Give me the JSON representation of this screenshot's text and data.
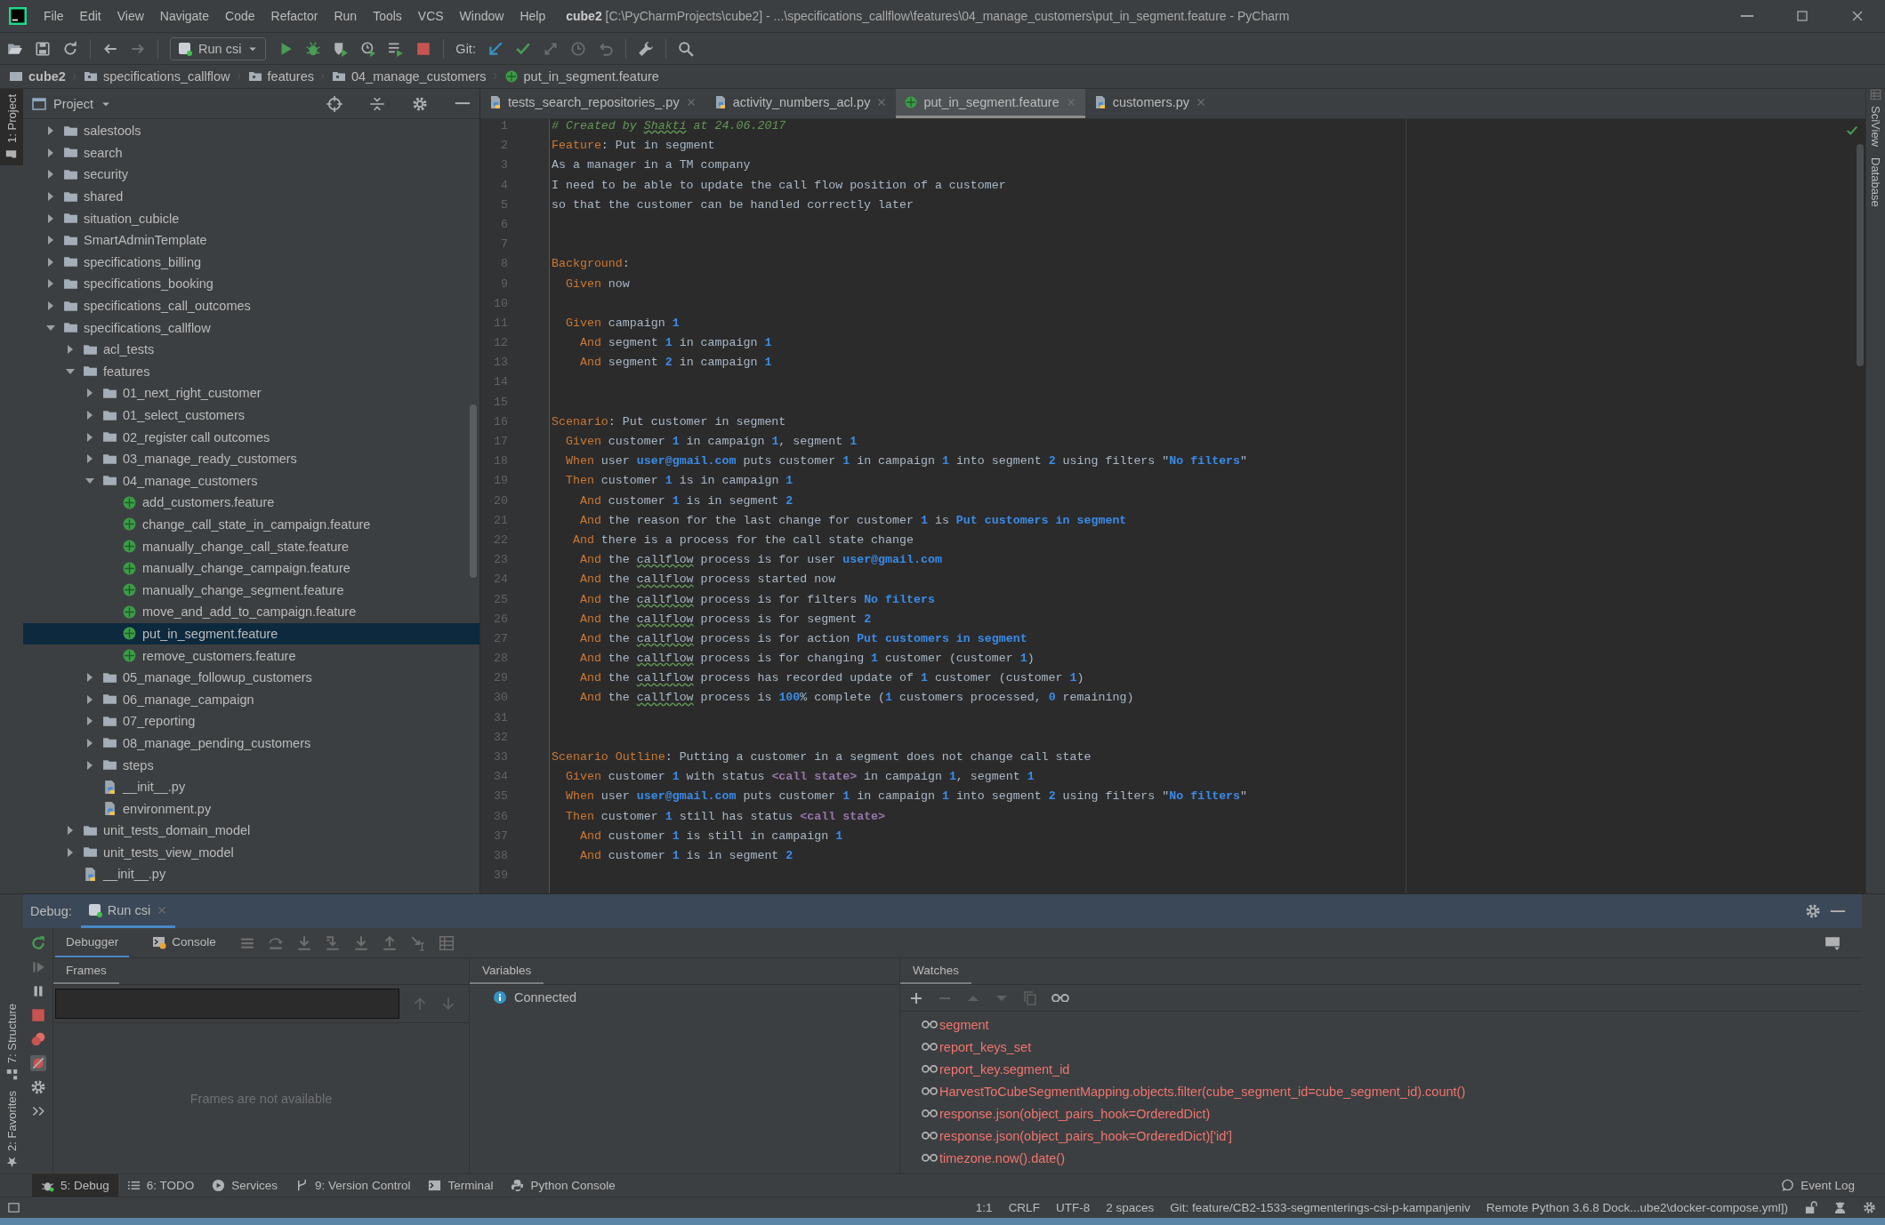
{
  "window": {
    "title": "**cube2** [C:\\PyCharmProjects\\cube2] - ...\\specifications_callflow\\features\\04_manage_customers\\put_in_segment.feature - PyCharm"
  },
  "menu": [
    "File",
    "Edit",
    "View",
    "Navigate",
    "Code",
    "Refactor",
    "Run",
    "Tools",
    "VCS",
    "Window",
    "Help"
  ],
  "toolbar": {
    "run_configuration": "Run csi",
    "vcs_label": "Git:"
  },
  "breadcrumbs": [
    {
      "text": "cube2",
      "kind": "project"
    },
    {
      "text": "specifications_callflow",
      "kind": "folder"
    },
    {
      "text": "features",
      "kind": "folder"
    },
    {
      "text": "04_manage_customers",
      "kind": "folder"
    },
    {
      "text": "put_in_segment.feature",
      "kind": "feature"
    }
  ],
  "side_stripes": {
    "left_top": [
      "1: Project"
    ],
    "left_bottom": [
      "7: Structure",
      "2: Favorites"
    ],
    "right": [
      "SciView",
      "Database"
    ]
  },
  "project": {
    "title": "Project",
    "tree": [
      {
        "label": "salestools",
        "kind": "folder",
        "expanded": false,
        "selected": false
      },
      {
        "label": "search",
        "kind": "folder",
        "expanded": false,
        "selected": false
      },
      {
        "label": "security",
        "kind": "folder",
        "expanded": false,
        "selected": false
      },
      {
        "label": "shared",
        "kind": "folder",
        "expanded": false,
        "selected": false
      },
      {
        "label": "situation_cubicle",
        "kind": "folder",
        "expanded": false,
        "selected": false
      },
      {
        "label": "SmartAdminTemplate",
        "kind": "folder",
        "expanded": false,
        "selected": false
      },
      {
        "label": "specifications_billing",
        "kind": "folder",
        "expanded": false,
        "selected": false
      },
      {
        "label": "specifications_booking",
        "kind": "folder",
        "expanded": false,
        "selected": false
      },
      {
        "label": "specifications_call_outcomes",
        "kind": "folder",
        "expanded": false,
        "selected": false
      },
      {
        "label": "specifications_callflow",
        "kind": "folder",
        "expanded": true,
        "selected": false,
        "children": [
          {
            "label": "acl_tests",
            "kind": "folder",
            "expanded": false,
            "selected": false
          },
          {
            "label": "features",
            "kind": "folder",
            "expanded": true,
            "selected": false,
            "children": [
              {
                "label": "01_next_right_customer",
                "kind": "folder",
                "expanded": false,
                "selected": false
              },
              {
                "label": "01_select_customers",
                "kind": "folder",
                "expanded": false,
                "selected": false
              },
              {
                "label": "02_register call outcomes",
                "kind": "folder",
                "expanded": false,
                "selected": false
              },
              {
                "label": "03_manage_ready_customers",
                "kind": "folder",
                "expanded": false,
                "selected": false
              },
              {
                "label": "04_manage_customers",
                "kind": "folder",
                "expanded": true,
                "selected": false,
                "children": [
                  {
                    "label": "add_customers.feature",
                    "kind": "feature",
                    "selected": false
                  },
                  {
                    "label": "change_call_state_in_campaign.feature",
                    "kind": "feature",
                    "selected": false
                  },
                  {
                    "label": "manually_change_call_state.feature",
                    "kind": "feature",
                    "selected": false
                  },
                  {
                    "label": "manually_change_campaign.feature",
                    "kind": "feature",
                    "selected": false
                  },
                  {
                    "label": "manually_change_segment.feature",
                    "kind": "feature",
                    "selected": false
                  },
                  {
                    "label": "move_and_add_to_campaign.feature",
                    "kind": "feature",
                    "selected": false
                  },
                  {
                    "label": "put_in_segment.feature",
                    "kind": "feature",
                    "selected": true
                  },
                  {
                    "label": "remove_customers.feature",
                    "kind": "feature",
                    "selected": false
                  }
                ]
              },
              {
                "label": "05_manage_followup_customers",
                "kind": "folder",
                "expanded": false,
                "selected": false
              },
              {
                "label": "06_manage_campaign",
                "kind": "folder",
                "expanded": false,
                "selected": false
              },
              {
                "label": "07_reporting",
                "kind": "folder",
                "expanded": false,
                "selected": false
              },
              {
                "label": "08_manage_pending_customers",
                "kind": "folder",
                "expanded": false,
                "selected": false
              },
              {
                "label": "steps",
                "kind": "folder",
                "expanded": false,
                "selected": false
              },
              {
                "label": "__init__.py",
                "kind": "python",
                "selected": false
              },
              {
                "label": "environment.py",
                "kind": "python",
                "selected": false
              }
            ]
          },
          {
            "label": "unit_tests_domain_model",
            "kind": "folder",
            "expanded": false,
            "selected": false
          },
          {
            "label": "unit_tests_view_model",
            "kind": "folder",
            "expanded": false,
            "selected": false
          },
          {
            "label": "__init__.py",
            "kind": "python",
            "selected": false
          }
        ]
      }
    ]
  },
  "editor": {
    "tabs": [
      {
        "label": "tests_search_repositories_.py",
        "kind": "python",
        "selected": false
      },
      {
        "label": "activity_numbers_acl.py",
        "kind": "python",
        "selected": false
      },
      {
        "label": "put_in_segment.feature",
        "kind": "feature",
        "selected": true
      },
      {
        "label": "customers.py",
        "kind": "python",
        "selected": false
      }
    ],
    "lines": [
      {
        "number": "1",
        "segments": [
          {
            "kind": "comment",
            "text": "# Created by "
          },
          {
            "kind": "comment-typo",
            "text": "Shakti"
          },
          {
            "kind": "comment",
            "text": " at 24.06.2017"
          }
        ]
      },
      {
        "number": "2",
        "segments": [
          {
            "kind": "keyword",
            "text": "Feature"
          },
          {
            "kind": "plain",
            "text": ": Put in segment"
          }
        ]
      },
      {
        "number": "3",
        "segments": [
          {
            "kind": "plain",
            "text": "As a manager in a TM company"
          }
        ]
      },
      {
        "number": "4",
        "segments": [
          {
            "kind": "plain",
            "text": "I need to be able to update the call flow position of a customer"
          }
        ]
      },
      {
        "number": "5",
        "segments": [
          {
            "kind": "plain",
            "text": "so that the customer can be handled correctly later"
          }
        ]
      },
      {
        "number": "6"
      },
      {
        "number": "7"
      },
      {
        "number": "8",
        "segments": [
          {
            "kind": "keyword",
            "text": "Background"
          },
          {
            "kind": "plain",
            "text": ":"
          }
        ]
      },
      {
        "number": "9",
        "segments": [
          {
            "kind": "keyword",
            "text": "  Given"
          },
          {
            "kind": "plain",
            "text": " now"
          }
        ]
      },
      {
        "number": "10"
      },
      {
        "number": "11",
        "segments": [
          {
            "kind": "keyword",
            "text": "  Given"
          },
          {
            "kind": "plain",
            "text": " campaign "
          },
          {
            "kind": "number",
            "text": "1"
          }
        ]
      },
      {
        "number": "12",
        "segments": [
          {
            "kind": "keyword",
            "text": "    And"
          },
          {
            "kind": "plain",
            "text": " segment "
          },
          {
            "kind": "number",
            "text": "1"
          },
          {
            "kind": "plain",
            "text": " in campaign "
          },
          {
            "kind": "number",
            "text": "1"
          }
        ]
      },
      {
        "number": "13",
        "segments": [
          {
            "kind": "keyword",
            "text": "    And"
          },
          {
            "kind": "plain",
            "text": " segment "
          },
          {
            "kind": "number",
            "text": "2"
          },
          {
            "kind": "plain",
            "text": " in campaign "
          },
          {
            "kind": "number",
            "text": "1"
          }
        ]
      },
      {
        "number": "14"
      },
      {
        "number": "15"
      },
      {
        "number": "16",
        "segments": [
          {
            "kind": "keyword",
            "text": "Scenario"
          },
          {
            "kind": "plain",
            "text": ": Put customer in segment"
          }
        ]
      },
      {
        "number": "17",
        "segments": [
          {
            "kind": "keyword",
            "text": "  Given"
          },
          {
            "kind": "plain",
            "text": " customer "
          },
          {
            "kind": "number",
            "text": "1"
          },
          {
            "kind": "plain",
            "text": " in campaign "
          },
          {
            "kind": "number",
            "text": "1"
          },
          {
            "kind": "plain",
            "text": ", segment "
          },
          {
            "kind": "number",
            "text": "1"
          }
        ]
      },
      {
        "number": "18",
        "segments": [
          {
            "kind": "keyword",
            "text": "  When"
          },
          {
            "kind": "plain",
            "text": " user "
          },
          {
            "kind": "string",
            "text": "user@gmail.com"
          },
          {
            "kind": "plain",
            "text": " puts customer "
          },
          {
            "kind": "number",
            "text": "1"
          },
          {
            "kind": "plain",
            "text": " in campaign "
          },
          {
            "kind": "number",
            "text": "1"
          },
          {
            "kind": "plain",
            "text": " into segment "
          },
          {
            "kind": "number",
            "text": "2"
          },
          {
            "kind": "plain",
            "text": " using filters \""
          },
          {
            "kind": "string",
            "text": "No filters"
          },
          {
            "kind": "plain",
            "text": "\""
          }
        ]
      },
      {
        "number": "19",
        "segments": [
          {
            "kind": "keyword",
            "text": "  Then"
          },
          {
            "kind": "plain",
            "text": " customer "
          },
          {
            "kind": "number",
            "text": "1"
          },
          {
            "kind": "plain",
            "text": " is in campaign "
          },
          {
            "kind": "number",
            "text": "1"
          }
        ]
      },
      {
        "number": "20",
        "segments": [
          {
            "kind": "keyword",
            "text": "    And"
          },
          {
            "kind": "plain",
            "text": " customer "
          },
          {
            "kind": "number",
            "text": "1"
          },
          {
            "kind": "plain",
            "text": " is in segment "
          },
          {
            "kind": "number",
            "text": "2"
          }
        ]
      },
      {
        "number": "21",
        "segments": [
          {
            "kind": "keyword",
            "text": "    And"
          },
          {
            "kind": "plain",
            "text": " the reason for the last change for customer "
          },
          {
            "kind": "number",
            "text": "1"
          },
          {
            "kind": "plain",
            "text": " is "
          },
          {
            "kind": "string",
            "text": "Put customers in segment"
          }
        ]
      },
      {
        "number": "22",
        "segments": [
          {
            "kind": "keyword",
            "text": "   And"
          },
          {
            "kind": "plain",
            "text": " there is a process for the call state change"
          }
        ]
      },
      {
        "number": "23",
        "segments": [
          {
            "kind": "keyword",
            "text": "    And"
          },
          {
            "kind": "plain",
            "text": " the "
          },
          {
            "kind": "typo",
            "text": "callflow"
          },
          {
            "kind": "plain",
            "text": " process is for user "
          },
          {
            "kind": "string",
            "text": "user@gmail.com"
          }
        ]
      },
      {
        "number": "24",
        "segments": [
          {
            "kind": "keyword",
            "text": "    And"
          },
          {
            "kind": "plain",
            "text": " the "
          },
          {
            "kind": "typo",
            "text": "callflow"
          },
          {
            "kind": "plain",
            "text": " process started now"
          }
        ]
      },
      {
        "number": "25",
        "segments": [
          {
            "kind": "keyword",
            "text": "    And"
          },
          {
            "kind": "plain",
            "text": " the "
          },
          {
            "kind": "typo",
            "text": "callflow"
          },
          {
            "kind": "plain",
            "text": " process is for filters "
          },
          {
            "kind": "string",
            "text": "No filters"
          }
        ]
      },
      {
        "number": "26",
        "segments": [
          {
            "kind": "keyword",
            "text": "    And"
          },
          {
            "kind": "plain",
            "text": " the "
          },
          {
            "kind": "typo",
            "text": "callflow"
          },
          {
            "kind": "plain",
            "text": " process is for segment "
          },
          {
            "kind": "number",
            "text": "2"
          }
        ]
      },
      {
        "number": "27",
        "segments": [
          {
            "kind": "keyword",
            "text": "    And"
          },
          {
            "kind": "plain",
            "text": " the "
          },
          {
            "kind": "typo",
            "text": "callflow"
          },
          {
            "kind": "plain",
            "text": " process is for action "
          },
          {
            "kind": "string",
            "text": "Put customers in segment"
          }
        ]
      },
      {
        "number": "28",
        "segments": [
          {
            "kind": "keyword",
            "text": "    And"
          },
          {
            "kind": "plain",
            "text": " the "
          },
          {
            "kind": "typo",
            "text": "callflow"
          },
          {
            "kind": "plain",
            "text": " process is for changing "
          },
          {
            "kind": "number",
            "text": "1"
          },
          {
            "kind": "plain",
            "text": " customer (customer "
          },
          {
            "kind": "number",
            "text": "1"
          },
          {
            "kind": "plain",
            "text": ")"
          }
        ]
      },
      {
        "number": "29",
        "segments": [
          {
            "kind": "keyword",
            "text": "    And"
          },
          {
            "kind": "plain",
            "text": " the "
          },
          {
            "kind": "typo",
            "text": "callflow"
          },
          {
            "kind": "plain",
            "text": " process has recorded update of "
          },
          {
            "kind": "number",
            "text": "1"
          },
          {
            "kind": "plain",
            "text": " customer (customer "
          },
          {
            "kind": "number",
            "text": "1"
          },
          {
            "kind": "plain",
            "text": ")"
          }
        ]
      },
      {
        "number": "30",
        "segments": [
          {
            "kind": "keyword",
            "text": "    And"
          },
          {
            "kind": "plain",
            "text": " the "
          },
          {
            "kind": "typo",
            "text": "callflow"
          },
          {
            "kind": "plain",
            "text": " process is "
          },
          {
            "kind": "number",
            "text": "100"
          },
          {
            "kind": "plain",
            "text": "% complete ("
          },
          {
            "kind": "number",
            "text": "1"
          },
          {
            "kind": "plain",
            "text": " customers processed, "
          },
          {
            "kind": "number",
            "text": "0"
          },
          {
            "kind": "plain",
            "text": " remaining)"
          }
        ]
      },
      {
        "number": "31"
      },
      {
        "number": "32"
      },
      {
        "number": "33",
        "segments": [
          {
            "kind": "keyword",
            "text": "Scenario Outline"
          },
          {
            "kind": "plain",
            "text": ": Putting a customer in a segment does not change call state"
          }
        ]
      },
      {
        "number": "34",
        "segments": [
          {
            "kind": "keyword",
            "text": "  Given"
          },
          {
            "kind": "plain",
            "text": " customer "
          },
          {
            "kind": "number",
            "text": "1"
          },
          {
            "kind": "plain",
            "text": " with status "
          },
          {
            "kind": "parameter",
            "text": "<call state>"
          },
          {
            "kind": "plain",
            "text": " in campaign "
          },
          {
            "kind": "number",
            "text": "1"
          },
          {
            "kind": "plain",
            "text": ", segment "
          },
          {
            "kind": "number",
            "text": "1"
          }
        ]
      },
      {
        "number": "35",
        "segments": [
          {
            "kind": "keyword",
            "text": "  When"
          },
          {
            "kind": "plain",
            "text": " user "
          },
          {
            "kind": "string",
            "text": "user@gmail.com"
          },
          {
            "kind": "plain",
            "text": " puts customer "
          },
          {
            "kind": "number",
            "text": "1"
          },
          {
            "kind": "plain",
            "text": " in campaign "
          },
          {
            "kind": "number",
            "text": "1"
          },
          {
            "kind": "plain",
            "text": " into segment "
          },
          {
            "kind": "number",
            "text": "2"
          },
          {
            "kind": "plain",
            "text": " using filters \""
          },
          {
            "kind": "string",
            "text": "No filters"
          },
          {
            "kind": "plain",
            "text": "\""
          }
        ]
      },
      {
        "number": "36",
        "segments": [
          {
            "kind": "keyword",
            "text": "  Then"
          },
          {
            "kind": "plain",
            "text": " customer "
          },
          {
            "kind": "number",
            "text": "1"
          },
          {
            "kind": "plain",
            "text": " still has status "
          },
          {
            "kind": "parameter",
            "text": "<call state>"
          }
        ]
      },
      {
        "number": "37",
        "segments": [
          {
            "kind": "keyword",
            "text": "    And"
          },
          {
            "kind": "plain",
            "text": " customer "
          },
          {
            "kind": "number",
            "text": "1"
          },
          {
            "kind": "plain",
            "text": " is still in campaign "
          },
          {
            "kind": "number",
            "text": "1"
          }
        ]
      },
      {
        "number": "38",
        "segments": [
          {
            "kind": "keyword",
            "text": "    And"
          },
          {
            "kind": "plain",
            "text": " customer "
          },
          {
            "kind": "number",
            "text": "1"
          },
          {
            "kind": "plain",
            "text": " is in segment "
          },
          {
            "kind": "number",
            "text": "2"
          }
        ]
      },
      {
        "number": "39"
      }
    ]
  },
  "debug": {
    "label": "Debug:",
    "tabs": [
      {
        "label": "Run csi",
        "selected": true
      }
    ],
    "subtabs": [
      {
        "label": "Debugger",
        "kind": "debugger",
        "selected": true
      },
      {
        "label": "Console",
        "kind": "console",
        "selected": false
      }
    ],
    "frames": {
      "title": "Frames",
      "empty_text": "Frames are not available"
    },
    "variables": {
      "title": "Variables",
      "status": "Connected"
    },
    "watches": {
      "title": "Watches",
      "items": [
        "segment",
        "report_keys_set",
        "report_key.segment_id",
        "HarvestToCubeSegmentMapping.objects.filter(cube_segment_id=cube_segment_id).count()",
        "response.json(object_pairs_hook=OrderedDict)",
        "response.json(object_pairs_hook=OrderedDict)['id']",
        "timezone.now().date()"
      ]
    }
  },
  "tool_tabs": [
    {
      "label": "5: Debug",
      "kind": "debug",
      "selected": true
    },
    {
      "label": "6: TODO",
      "kind": "todo",
      "selected": false
    },
    {
      "label": "Services",
      "kind": "services",
      "selected": false
    },
    {
      "label": "9: Version Control",
      "kind": "vcs",
      "selected": false
    },
    {
      "label": "Terminal",
      "kind": "terminal",
      "selected": false
    },
    {
      "label": "Python Console",
      "kind": "python",
      "selected": false
    }
  ],
  "event_log": "Event Log",
  "status_bar": [
    "1:1",
    "CRLF",
    "UTF-8",
    "2 spaces",
    "Git: feature/CB2-1533-segmenterings-csi-p-kampanjeniv",
    "Remote Python 3.6.8 Dock...ube2\\docker-compose.yml])"
  ]
}
